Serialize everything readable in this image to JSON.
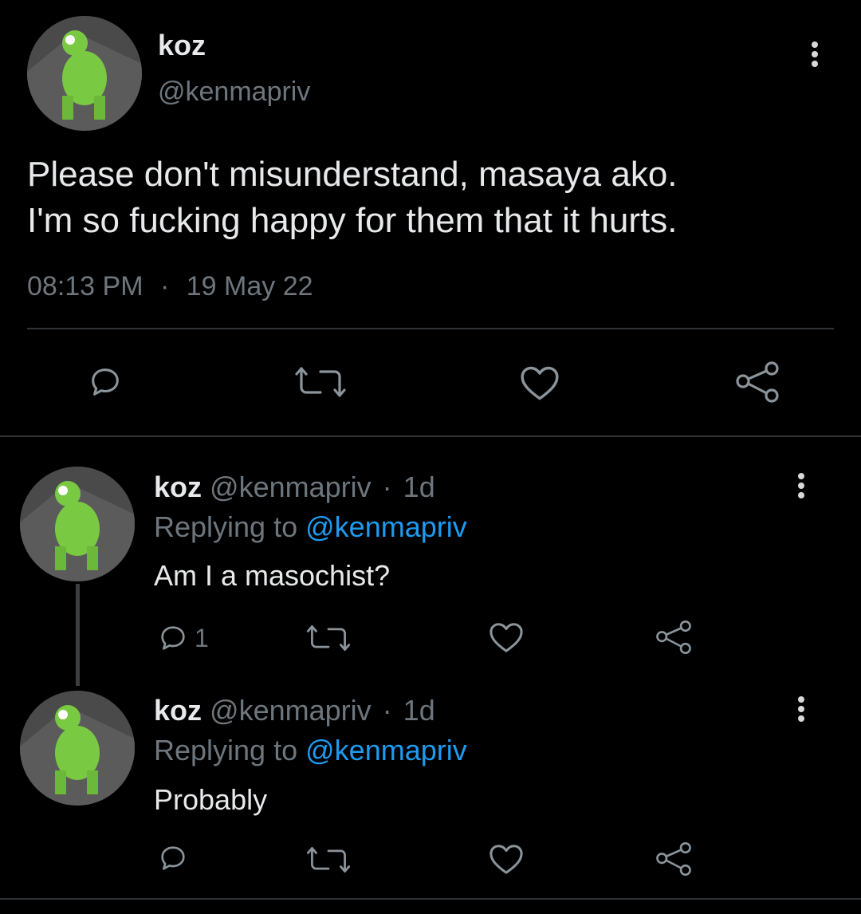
{
  "main_tweet": {
    "display_name": "koz",
    "handle": "@kenmapriv",
    "text_line1": "Please don't misunderstand, masaya ako.",
    "text_line2": "I'm so fucking happy for them that it hurts.",
    "time": "08:13 PM",
    "separator": "·",
    "date": "19 May 22"
  },
  "replies": [
    {
      "display_name": "koz",
      "handle": "@kenmapriv",
      "separator": "·",
      "age": "1d",
      "replying_prefix": "Replying to",
      "replying_to": "@kenmapriv",
      "text": "Am I a masochist?",
      "reply_count": "1"
    },
    {
      "display_name": "koz",
      "handle": "@kenmapriv",
      "separator": "·",
      "age": "1d",
      "replying_prefix": "Replying to",
      "replying_to": "@kenmapriv",
      "text": "Probably",
      "reply_count": ""
    }
  ],
  "icons": [
    "reply-icon",
    "retweet-icon",
    "like-icon",
    "share-icon",
    "more-options-icon"
  ],
  "colors": {
    "background": "#000000",
    "text": "#e7e9ea",
    "muted": "#6e767d",
    "link": "#1d9bf0",
    "divider": "#2f3336"
  }
}
